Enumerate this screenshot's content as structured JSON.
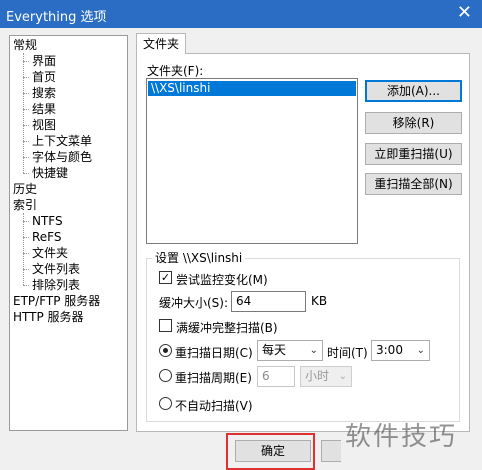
{
  "window": {
    "title": "Everything 选项",
    "close_glyph": "✕"
  },
  "tree": {
    "general": "常规",
    "general_children": [
      "界面",
      "首页",
      "搜索",
      "结果",
      "视图",
      "上下文菜单",
      "字体与颜色",
      "快捷键"
    ],
    "history": "历史",
    "index": "索引",
    "index_children": [
      "NTFS",
      "ReFS",
      "文件夹",
      "文件列表",
      "排除列表"
    ],
    "ftp": "ETP/FTP 服务器",
    "http": "HTTP 服务器"
  },
  "tab": {
    "label": "文件夹"
  },
  "folders": {
    "label": "文件夹(F):",
    "items": [
      "\\\\XS\\linshi"
    ],
    "buttons": {
      "add": "添加(A)...",
      "remove": "移除(R)",
      "rescan_now": "立即重扫描(U)",
      "rescan_all": "重扫描全部(N)"
    }
  },
  "settings": {
    "legend": "设置 \\\\XS\\linshi",
    "monitor_label": "尝试监控变化(M)",
    "monitor_checked": true,
    "buffer_label": "缓冲大小(S):",
    "buffer_value": "64",
    "buffer_unit": "KB",
    "rescan_full_label": "满缓冲完整扫描(B)",
    "rescan_full_checked": false,
    "daily_label": "重扫描日期(C)",
    "daily_selected": true,
    "daily_option": "每天",
    "time_label": "时间(T)",
    "time_value": "3:00",
    "periodic_label": "重扫描周期(E)",
    "periodic_selected": false,
    "periodic_value": "6",
    "periodic_unit": "小时",
    "never_label": "不自动扫描(V)",
    "never_selected": false
  },
  "footer": {
    "ok": "确定"
  },
  "watermark": "软件技巧",
  "colors": {
    "titlebar": "#2b6cc4",
    "selection": "#0078d7",
    "highlight_box": "#e0302f"
  }
}
